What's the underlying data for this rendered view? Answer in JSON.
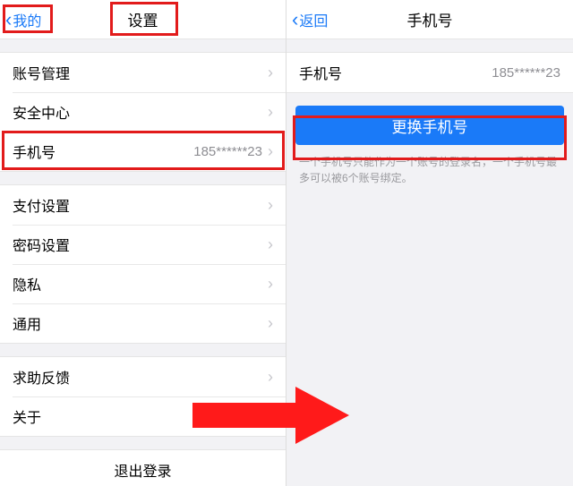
{
  "left": {
    "nav": {
      "back": "我的",
      "title": "设置"
    },
    "groups": [
      [
        {
          "label": "账号管理"
        },
        {
          "label": "安全中心"
        },
        {
          "label": "手机号",
          "value": "185******23"
        }
      ],
      [
        {
          "label": "支付设置"
        },
        {
          "label": "密码设置"
        },
        {
          "label": "隐私"
        },
        {
          "label": "通用"
        }
      ],
      [
        {
          "label": "求助反馈"
        },
        {
          "label": "关于"
        }
      ]
    ],
    "logout": "退出登录"
  },
  "right": {
    "nav": {
      "back": "返回",
      "title": "手机号"
    },
    "row": {
      "label": "手机号",
      "value": "185******23"
    },
    "button": "更换手机号",
    "hint": "一个手机号只能作为一个账号的登录名，一个手机号最多可以被6个账号绑定。"
  }
}
